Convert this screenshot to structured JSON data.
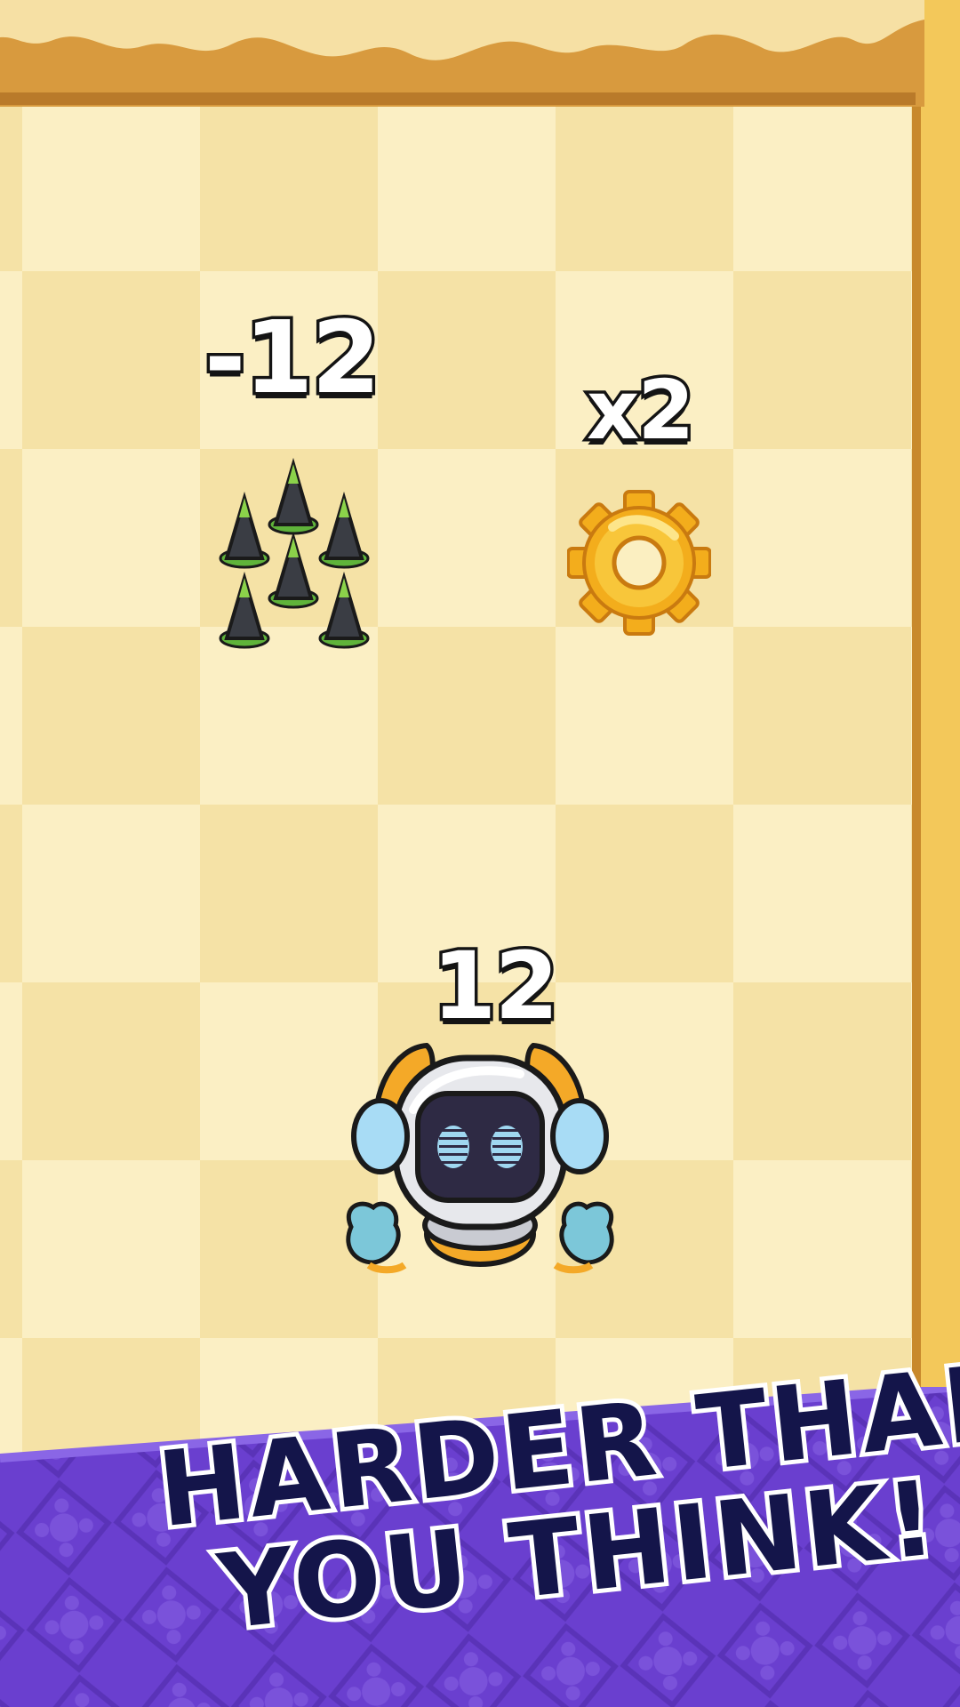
{
  "board": {
    "trap": {
      "value_label": "-12",
      "icon": "spike-trap-icon"
    },
    "bonus": {
      "value_label": "x2",
      "icon": "gear-icon"
    },
    "player": {
      "value_label": "12",
      "icon": "robot-icon"
    }
  },
  "banner": {
    "line1": "HARDER THAN",
    "line2": "YOU THINK!"
  },
  "colors": {
    "banner_purple": "#6a3fcf",
    "slogan_navy": "#14154a",
    "gear_gold": "#f6b81f",
    "wall_orange": "#d7953a"
  }
}
